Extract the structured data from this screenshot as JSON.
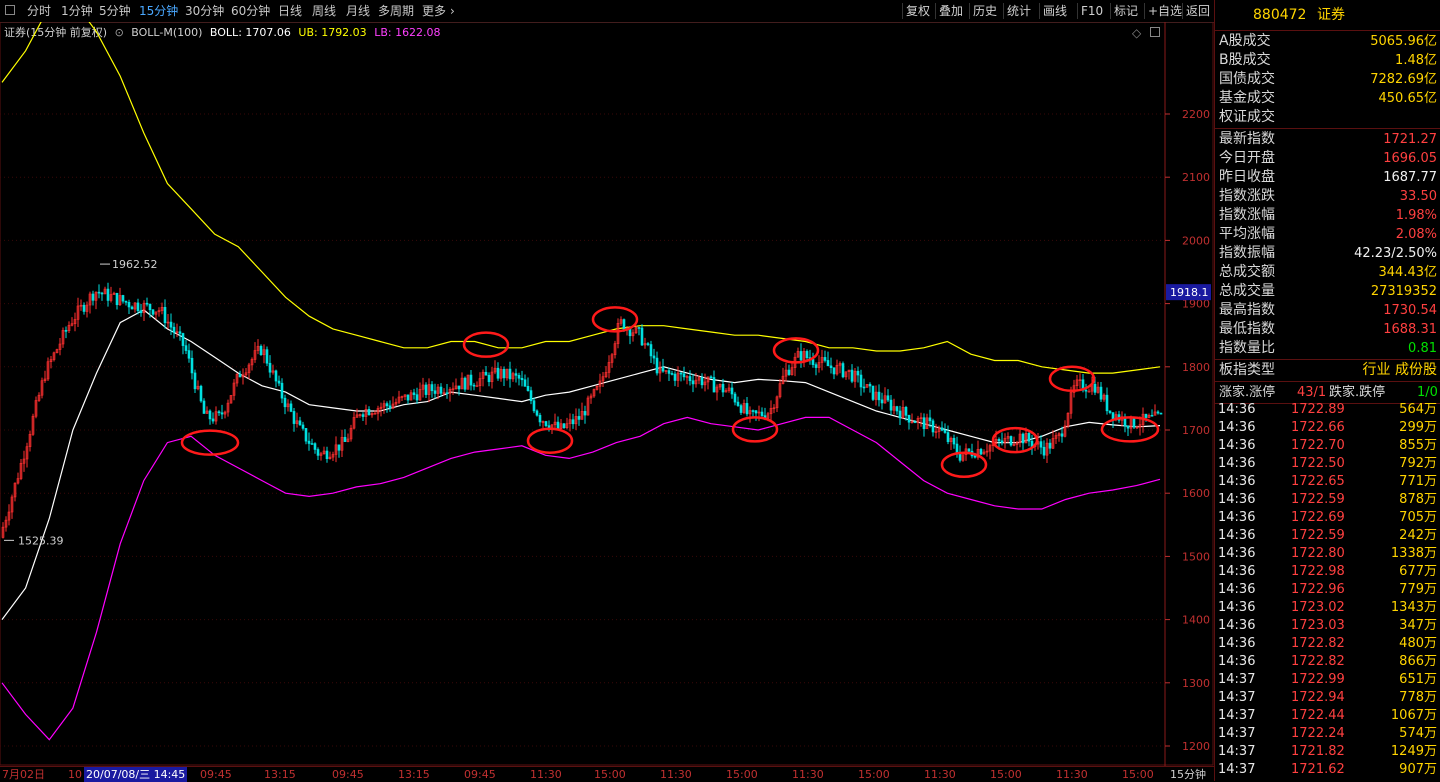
{
  "toolbar": {
    "periods": [
      "分时",
      "1分钟",
      "5分钟",
      "15分钟",
      "30分钟",
      "60分钟",
      "日线",
      "周线",
      "月线",
      "多周期",
      "更多"
    ],
    "active_period": "15分钟",
    "more_icon": "chevron-right-icon",
    "buttons": [
      "复权",
      "叠加",
      "历史",
      "统计",
      "画线",
      "F10",
      "标记",
      "+自选",
      "返回"
    ]
  },
  "info": {
    "title": "证券(15分钟 前复权)",
    "indicator": "BOLL-M(100)",
    "boll": "BOLL: 1707.06",
    "ub": "UB: 1792.03",
    "lb": "LB: 1622.08"
  },
  "colors": {
    "up": "#ff3030",
    "down": "#00e0e0",
    "boll_mid": "#ffffff",
    "boll_ub": "#ffff00",
    "boll_lb": "#ff00ff",
    "circle": "#ff1a1a",
    "axis": "#c03030"
  },
  "chart_data": {
    "type": "candlestick",
    "ylim": [
      1180,
      2380
    ],
    "yticks": [
      1200,
      1300,
      1400,
      1500,
      1600,
      1700,
      1800,
      1900,
      2000,
      2100,
      2200
    ],
    "current_price_label": "1918.1",
    "annotations": {
      "high": "1962.52",
      "low": "1525.39"
    },
    "x_labels": [
      "7月02日",
      "10",
      "20/07/08/三 14:45",
      "09:45",
      "13:15",
      "09:45",
      "13:15",
      "09:45",
      "11:30",
      "15:00",
      "11:30",
      "15:00",
      "11:30",
      "15:00",
      "11:30",
      "15:00",
      "11:30",
      "15:00",
      "15分钟"
    ],
    "ub_series": [
      2250,
      2300,
      2370,
      2380,
      2330,
      2260,
      2170,
      2090,
      2050,
      2010,
      1990,
      1950,
      1910,
      1880,
      1860,
      1850,
      1840,
      1830,
      1830,
      1840,
      1840,
      1830,
      1830,
      1840,
      1840,
      1850,
      1860,
      1865,
      1865,
      1860,
      1855,
      1850,
      1850,
      1845,
      1840,
      1830,
      1830,
      1825,
      1825,
      1830,
      1840,
      1820,
      1810,
      1810,
      1800,
      1795,
      1790,
      1790,
      1795,
      1800
    ],
    "mid_series": [
      1400,
      1450,
      1560,
      1700,
      1790,
      1870,
      1890,
      1860,
      1840,
      1815,
      1790,
      1770,
      1760,
      1740,
      1735,
      1730,
      1730,
      1740,
      1745,
      1760,
      1755,
      1750,
      1745,
      1755,
      1760,
      1770,
      1780,
      1790,
      1800,
      1790,
      1780,
      1775,
      1780,
      1778,
      1775,
      1760,
      1745,
      1730,
      1720,
      1710,
      1700,
      1690,
      1680,
      1680,
      1690,
      1705,
      1712,
      1708,
      1705,
      1707
    ],
    "lb_series": [
      1300,
      1250,
      1210,
      1260,
      1380,
      1520,
      1620,
      1680,
      1690,
      1660,
      1640,
      1620,
      1600,
      1595,
      1600,
      1610,
      1615,
      1625,
      1640,
      1655,
      1665,
      1670,
      1675,
      1660,
      1655,
      1665,
      1680,
      1690,
      1710,
      1720,
      1710,
      1705,
      1700,
      1710,
      1720,
      1720,
      1700,
      1680,
      1650,
      1620,
      1600,
      1590,
      1580,
      1575,
      1575,
      1590,
      1600,
      1605,
      1612,
      1622
    ],
    "circles": [
      {
        "x": 210,
        "y": 1680
      },
      {
        "x": 486,
        "y": 1835
      },
      {
        "x": 550,
        "y": 1683
      },
      {
        "x": 615,
        "y": 1875
      },
      {
        "x": 755,
        "y": 1701
      },
      {
        "x": 796,
        "y": 1826
      },
      {
        "x": 964,
        "y": 1645
      },
      {
        "x": 1015,
        "y": 1684
      },
      {
        "x": 1072,
        "y": 1781
      },
      {
        "x": 1130,
        "y": 1701
      }
    ]
  },
  "right_panel": {
    "code": "880472",
    "name": "证券",
    "volume_rows": [
      {
        "k": "A股成交",
        "v": "5065.96亿",
        "c": "yellow"
      },
      {
        "k": "B股成交",
        "v": "1.48亿",
        "c": "yellow"
      },
      {
        "k": "国债成交",
        "v": "7282.69亿",
        "c": "yellow"
      },
      {
        "k": "基金成交",
        "v": "450.65亿",
        "c": "yellow"
      },
      {
        "k": "权证成交",
        "v": "",
        "c": "yellow"
      }
    ],
    "stat_rows": [
      {
        "k": "最新指数",
        "v": "1721.27",
        "c": "red"
      },
      {
        "k": "今日开盘",
        "v": "1696.05",
        "c": "red"
      },
      {
        "k": "昨日收盘",
        "v": "1687.77",
        "c": "white"
      },
      {
        "k": "指数涨跌",
        "v": "33.50",
        "c": "red"
      },
      {
        "k": "指数涨幅",
        "v": "1.98%",
        "c": "red"
      },
      {
        "k": "平均涨幅",
        "v": "2.08%",
        "c": "red"
      },
      {
        "k": "指数振幅",
        "v": "42.23/2.50%",
        "c": "white"
      },
      {
        "k": "总成交额",
        "v": "344.43亿",
        "c": "yellow"
      },
      {
        "k": "总成交量",
        "v": "27319352",
        "c": "yellow"
      },
      {
        "k": "最高指数",
        "v": "1730.54",
        "c": "red"
      },
      {
        "k": "最低指数",
        "v": "1688.31",
        "c": "red"
      },
      {
        "k": "指数量比",
        "v": "0.81",
        "c": "green"
      }
    ],
    "type_row": {
      "k": "板指类型",
      "v": "行业 成份股"
    },
    "updown_row": {
      "k": "涨家.涨停",
      "v1": "43/1",
      "k2": "跌家.跌停",
      "v2": "1/0"
    },
    "ticks": [
      {
        "t": "14:36",
        "p": "1722.89",
        "q": "564万"
      },
      {
        "t": "14:36",
        "p": "1722.66",
        "q": "299万"
      },
      {
        "t": "14:36",
        "p": "1722.70",
        "q": "855万"
      },
      {
        "t": "14:36",
        "p": "1722.50",
        "q": "792万"
      },
      {
        "t": "14:36",
        "p": "1722.65",
        "q": "771万"
      },
      {
        "t": "14:36",
        "p": "1722.59",
        "q": "878万"
      },
      {
        "t": "14:36",
        "p": "1722.69",
        "q": "705万"
      },
      {
        "t": "14:36",
        "p": "1722.59",
        "q": "242万"
      },
      {
        "t": "14:36",
        "p": "1722.80",
        "q": "1338万"
      },
      {
        "t": "14:36",
        "p": "1722.98",
        "q": "677万"
      },
      {
        "t": "14:36",
        "p": "1722.96",
        "q": "779万"
      },
      {
        "t": "14:36",
        "p": "1723.02",
        "q": "1343万"
      },
      {
        "t": "14:36",
        "p": "1723.03",
        "q": "347万"
      },
      {
        "t": "14:36",
        "p": "1722.82",
        "q": "480万"
      },
      {
        "t": "14:36",
        "p": "1722.82",
        "q": "866万"
      },
      {
        "t": "14:37",
        "p": "1722.99",
        "q": "651万"
      },
      {
        "t": "14:37",
        "p": "1722.94",
        "q": "778万"
      },
      {
        "t": "14:37",
        "p": "1722.44",
        "q": "1067万"
      },
      {
        "t": "14:37",
        "p": "1722.24",
        "q": "574万"
      },
      {
        "t": "14:37",
        "p": "1721.82",
        "q": "1249万"
      },
      {
        "t": "14:37",
        "p": "1721.62",
        "q": "907万"
      }
    ]
  }
}
